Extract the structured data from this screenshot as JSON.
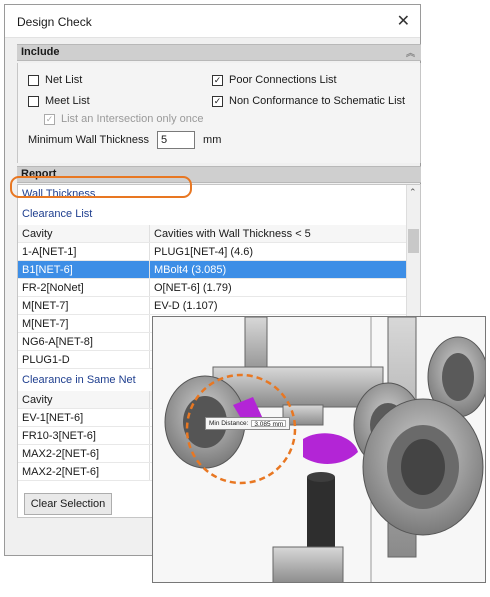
{
  "window": {
    "title": "Design Check",
    "close_glyph": "✕"
  },
  "include": {
    "header": "Include",
    "net_list": "Net List",
    "meet_list": "Meet List",
    "list_intersection_once": "List an Intersection only once",
    "poor_connections": "Poor Connections List",
    "non_conformance": "Non Conformance to Schematic List",
    "min_wall_label": "Minimum Wall Thickness",
    "min_wall_value": "5",
    "min_wall_unit": "mm",
    "checked": {
      "net_list": false,
      "meet_list": false,
      "list_intersection_once": true,
      "poor_connections": true,
      "non_conformance": true
    }
  },
  "report": {
    "header": "Report",
    "wall_thickness": "Wall Thickness",
    "clearance_list": "Clearance List",
    "col_cavity": "Cavity",
    "col_cavities_wall": "Cavities with Wall Thickness < 5",
    "rows": [
      {
        "cavity": "1-A[NET-1]",
        "value": "PLUG1[NET-4] (4.6)"
      },
      {
        "cavity": "B1[NET-6]",
        "value": "MBolt4 (3.085)"
      },
      {
        "cavity": "FR-2[NoNet]",
        "value": "O[NET-6] (1.79)"
      },
      {
        "cavity": "M[NET-7]",
        "value": "EV-D (1.107)"
      },
      {
        "cavity": "M[NET-7]",
        "value": ""
      },
      {
        "cavity": "NG6-A[NET-8]",
        "value": ""
      },
      {
        "cavity": "PLUG1-D",
        "value": ""
      }
    ],
    "selected_index": 1,
    "clearance_same_net": "Clearance in Same Net",
    "col_cavity_2": "Cavity",
    "rows2": [
      "EV-1[NET-6]",
      "FR10-3[NET-6]",
      "MAX2-2[NET-6]",
      "MAX2-2[NET-6]"
    ]
  },
  "buttons": {
    "clear_selection": "Clear Selection"
  },
  "inset": {
    "tooltip_label": "Min Distance:",
    "tooltip_value": "3.085 mm"
  },
  "colors": {
    "selection": "#3d8ee6",
    "highlight_ring": "#e87722",
    "magenta_part": "#b325d6"
  },
  "icons": {
    "close": "close-icon",
    "collapse": "collapse-chevrons-icon",
    "filter": "filter-icon",
    "scroll_up": "chevron-up-icon"
  }
}
